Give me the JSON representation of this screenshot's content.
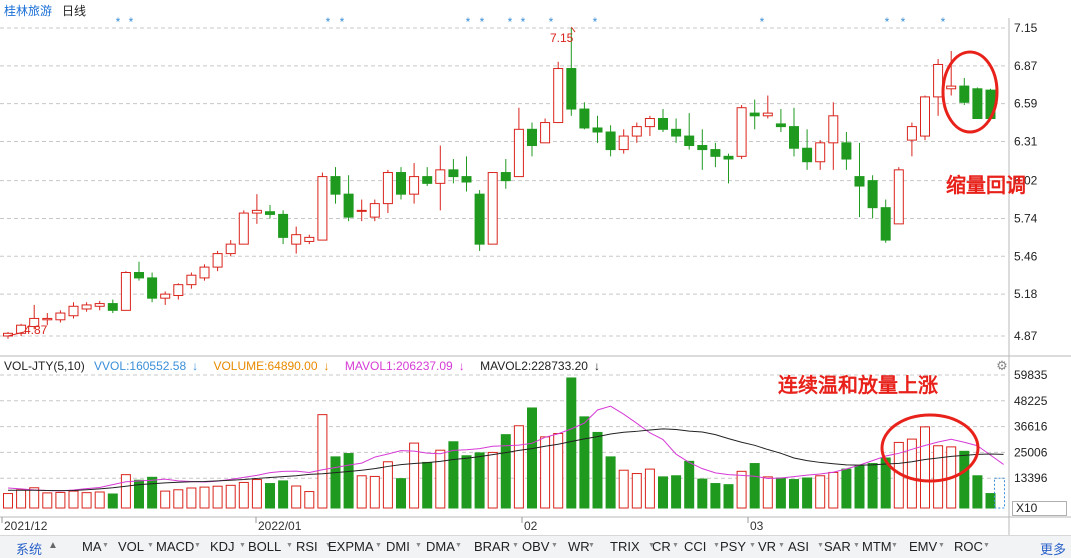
{
  "header": {
    "stock_name": "桂林旅游",
    "period": "日线"
  },
  "price_axis": [
    "7.15",
    "6.87",
    "6.59",
    "6.31",
    "6.02",
    "5.74",
    "5.46",
    "5.18",
    "4.87"
  ],
  "volume_axis": [
    "59835",
    "48225",
    "36616",
    "25006",
    "13396"
  ],
  "date_labels": [
    "2021/12",
    "2022/01",
    "02",
    "03"
  ],
  "peak_label": "7.15",
  "low_label": "4.87",
  "annotations": {
    "top_right": "缩量回调",
    "bottom_right": "连续温和放量上涨"
  },
  "volume_indicator": {
    "name": "VOL-JTY(5,10)",
    "vvol": "VVOL:160552.58",
    "volume": "VOLUME:64890.00",
    "mavol1": "MAVOL1:206237.09",
    "mavol2": "MAVOL2:228733.20",
    "arrow": "↓"
  },
  "x10_label": "X10",
  "bottom_tabs": [
    "系统",
    "MA",
    "VOL",
    "MACD",
    "KDJ",
    "BOLL",
    "RSI",
    "EXPMA",
    "DMI",
    "DMA",
    "BRAR",
    "OBV",
    "WR",
    "TRIX",
    "CR",
    "CCI",
    "PSY",
    "VR",
    "ASI",
    "SAR",
    "MTM",
    "EMV",
    "ROC"
  ],
  "more_label": "更多",
  "colors": {
    "up": "#d9231b",
    "down": "#1f9a1f",
    "ma1": "#d63ad6",
    "ma2": "#222222",
    "vvol": "#3a8fd9",
    "volume": "#e88a00",
    "grid": "#c8c8c8",
    "circle": "#e8221b"
  },
  "chart_data": {
    "type": "candlestick",
    "price_ylim": [
      4.87,
      7.15
    ],
    "volume_ylim": [
      0,
      59835
    ],
    "candles": [
      {
        "o": 4.87,
        "h": 4.9,
        "l": 4.85,
        "c": 4.89,
        "v": 6500
      },
      {
        "o": 4.89,
        "h": 4.96,
        "l": 4.87,
        "c": 4.95,
        "v": 8200
      },
      {
        "o": 4.94,
        "h": 5.1,
        "l": 4.92,
        "c": 5.0,
        "v": 9100
      },
      {
        "o": 4.99,
        "h": 5.04,
        "l": 4.95,
        "c": 5.0,
        "v": 6800
      },
      {
        "o": 4.99,
        "h": 5.06,
        "l": 4.97,
        "c": 5.04,
        "v": 7000
      },
      {
        "o": 5.02,
        "h": 5.12,
        "l": 5.0,
        "c": 5.09,
        "v": 7600
      },
      {
        "o": 5.07,
        "h": 5.12,
        "l": 5.05,
        "c": 5.1,
        "v": 6900
      },
      {
        "o": 5.09,
        "h": 5.13,
        "l": 5.06,
        "c": 5.11,
        "v": 7200
      },
      {
        "o": 5.11,
        "h": 5.14,
        "l": 5.04,
        "c": 5.06,
        "v": 6300
      },
      {
        "o": 5.06,
        "h": 5.35,
        "l": 5.06,
        "c": 5.34,
        "v": 15000
      },
      {
        "o": 5.34,
        "h": 5.42,
        "l": 5.28,
        "c": 5.3,
        "v": 12500
      },
      {
        "o": 5.3,
        "h": 5.34,
        "l": 5.12,
        "c": 5.15,
        "v": 13800
      },
      {
        "o": 5.15,
        "h": 5.2,
        "l": 5.1,
        "c": 5.18,
        "v": 7600
      },
      {
        "o": 5.17,
        "h": 5.26,
        "l": 5.14,
        "c": 5.25,
        "v": 8200
      },
      {
        "o": 5.25,
        "h": 5.34,
        "l": 5.22,
        "c": 5.32,
        "v": 9000
      },
      {
        "o": 5.3,
        "h": 5.4,
        "l": 5.28,
        "c": 5.38,
        "v": 9400
      },
      {
        "o": 5.38,
        "h": 5.5,
        "l": 5.35,
        "c": 5.48,
        "v": 9800
      },
      {
        "o": 5.48,
        "h": 5.58,
        "l": 5.46,
        "c": 5.55,
        "v": 10200
      },
      {
        "o": 5.55,
        "h": 5.8,
        "l": 5.55,
        "c": 5.78,
        "v": 11500
      },
      {
        "o": 5.78,
        "h": 5.92,
        "l": 5.7,
        "c": 5.8,
        "v": 12800
      },
      {
        "o": 5.79,
        "h": 5.84,
        "l": 5.74,
        "c": 5.77,
        "v": 11000
      },
      {
        "o": 5.77,
        "h": 5.8,
        "l": 5.55,
        "c": 5.6,
        "v": 12200
      },
      {
        "o": 5.55,
        "h": 5.68,
        "l": 5.48,
        "c": 5.62,
        "v": 9900
      },
      {
        "o": 5.57,
        "h": 5.62,
        "l": 5.55,
        "c": 5.6,
        "v": 7400
      },
      {
        "o": 5.58,
        "h": 6.08,
        "l": 5.58,
        "c": 6.05,
        "v": 42000
      },
      {
        "o": 6.05,
        "h": 6.12,
        "l": 5.85,
        "c": 5.92,
        "v": 23000
      },
      {
        "o": 5.92,
        "h": 6.06,
        "l": 5.72,
        "c": 5.75,
        "v": 24500
      },
      {
        "o": 5.8,
        "h": 5.88,
        "l": 5.72,
        "c": 5.8,
        "v": 14500
      },
      {
        "o": 5.75,
        "h": 5.88,
        "l": 5.72,
        "c": 5.85,
        "v": 14200
      },
      {
        "o": 5.85,
        "h": 6.1,
        "l": 5.78,
        "c": 6.08,
        "v": 20800
      },
      {
        "o": 6.08,
        "h": 6.12,
        "l": 5.88,
        "c": 5.92,
        "v": 13200
      },
      {
        "o": 5.92,
        "h": 6.15,
        "l": 5.85,
        "c": 6.05,
        "v": 29200
      },
      {
        "o": 6.05,
        "h": 6.12,
        "l": 5.98,
        "c": 6.0,
        "v": 20500
      },
      {
        "o": 6.0,
        "h": 6.28,
        "l": 5.8,
        "c": 6.1,
        "v": 26000
      },
      {
        "o": 6.1,
        "h": 6.18,
        "l": 6.0,
        "c": 6.05,
        "v": 29800
      },
      {
        "o": 6.05,
        "h": 6.2,
        "l": 5.94,
        "c": 6.01,
        "v": 23500
      },
      {
        "o": 5.92,
        "h": 5.95,
        "l": 5.5,
        "c": 5.55,
        "v": 24800
      },
      {
        "o": 5.55,
        "h": 6.08,
        "l": 5.55,
        "c": 6.08,
        "v": 25000
      },
      {
        "o": 6.08,
        "h": 6.18,
        "l": 5.96,
        "c": 6.02,
        "v": 33000
      },
      {
        "o": 6.05,
        "h": 6.56,
        "l": 6.05,
        "c": 6.4,
        "v": 37000
      },
      {
        "o": 6.4,
        "h": 6.45,
        "l": 6.2,
        "c": 6.28,
        "v": 45000
      },
      {
        "o": 6.3,
        "h": 6.48,
        "l": 6.3,
        "c": 6.45,
        "v": 32000
      },
      {
        "o": 6.45,
        "h": 6.9,
        "l": 6.45,
        "c": 6.85,
        "v": 33500
      },
      {
        "o": 6.85,
        "h": 7.15,
        "l": 6.5,
        "c": 6.55,
        "v": 58500
      },
      {
        "o": 6.55,
        "h": 6.6,
        "l": 6.4,
        "c": 6.41,
        "v": 41000
      },
      {
        "o": 6.41,
        "h": 6.5,
        "l": 6.3,
        "c": 6.38,
        "v": 34000
      },
      {
        "o": 6.38,
        "h": 6.43,
        "l": 6.2,
        "c": 6.25,
        "v": 23000
      },
      {
        "o": 6.25,
        "h": 6.4,
        "l": 6.22,
        "c": 6.35,
        "v": 17000
      },
      {
        "o": 6.35,
        "h": 6.45,
        "l": 6.3,
        "c": 6.42,
        "v": 15500
      },
      {
        "o": 6.42,
        "h": 6.5,
        "l": 6.35,
        "c": 6.48,
        "v": 17500
      },
      {
        "o": 6.48,
        "h": 6.55,
        "l": 6.38,
        "c": 6.4,
        "v": 14000
      },
      {
        "o": 6.4,
        "h": 6.48,
        "l": 6.3,
        "c": 6.35,
        "v": 14500
      },
      {
        "o": 6.35,
        "h": 6.52,
        "l": 6.25,
        "c": 6.28,
        "v": 21000
      },
      {
        "o": 6.28,
        "h": 6.4,
        "l": 6.1,
        "c": 6.25,
        "v": 13000
      },
      {
        "o": 6.25,
        "h": 6.3,
        "l": 6.12,
        "c": 6.2,
        "v": 11000
      },
      {
        "o": 6.2,
        "h": 6.22,
        "l": 6.0,
        "c": 6.18,
        "v": 10500
      },
      {
        "o": 6.2,
        "h": 6.58,
        "l": 6.18,
        "c": 6.56,
        "v": 16500
      },
      {
        "o": 6.52,
        "h": 6.62,
        "l": 6.4,
        "c": 6.5,
        "v": 20000
      },
      {
        "o": 6.5,
        "h": 6.65,
        "l": 6.48,
        "c": 6.52,
        "v": 14000
      },
      {
        "o": 6.44,
        "h": 6.55,
        "l": 6.38,
        "c": 6.42,
        "v": 13500
      },
      {
        "o": 6.42,
        "h": 6.56,
        "l": 6.2,
        "c": 6.26,
        "v": 12800
      },
      {
        "o": 6.26,
        "h": 6.4,
        "l": 6.1,
        "c": 6.16,
        "v": 13500
      },
      {
        "o": 6.16,
        "h": 6.32,
        "l": 6.1,
        "c": 6.3,
        "v": 14500
      },
      {
        "o": 6.3,
        "h": 6.6,
        "l": 6.1,
        "c": 6.5,
        "v": 16000
      },
      {
        "o": 6.3,
        "h": 6.38,
        "l": 6.1,
        "c": 6.18,
        "v": 17500
      },
      {
        "o": 6.05,
        "h": 6.3,
        "l": 5.75,
        "c": 5.98,
        "v": 19000
      },
      {
        "o": 6.02,
        "h": 6.06,
        "l": 5.74,
        "c": 5.82,
        "v": 20000
      },
      {
        "o": 5.82,
        "h": 5.88,
        "l": 5.56,
        "c": 5.58,
        "v": 22500
      },
      {
        "o": 5.7,
        "h": 6.12,
        "l": 5.7,
        "c": 6.1,
        "v": 29500
      },
      {
        "o": 6.32,
        "h": 6.45,
        "l": 6.2,
        "c": 6.42,
        "v": 31000
      },
      {
        "o": 6.35,
        "h": 6.65,
        "l": 6.32,
        "c": 6.64,
        "v": 36500
      },
      {
        "o": 6.64,
        "h": 6.92,
        "l": 6.5,
        "c": 6.88,
        "v": 28000
      },
      {
        "o": 6.7,
        "h": 6.98,
        "l": 6.65,
        "c": 6.72,
        "v": 27500
      },
      {
        "o": 6.72,
        "h": 6.78,
        "l": 6.58,
        "c": 6.6,
        "v": 25500
      },
      {
        "o": 6.7,
        "h": 6.71,
        "l": 6.48,
        "c": 6.48,
        "v": 14500
      },
      {
        "o": 6.69,
        "h": 6.7,
        "l": 6.48,
        "c": 6.48,
        "v": 6500
      }
    ],
    "mavol1": [
      9000,
      8600,
      8100,
      7900,
      7700,
      8100,
      8700,
      9200,
      10500,
      11800,
      12200,
      12500,
      13000,
      12200,
      11900,
      11700,
      12100,
      12900,
      13800,
      14700,
      15900,
      16500,
      16600,
      16000,
      17200,
      18200,
      19300,
      20200,
      22900,
      24300,
      25800,
      25600,
      24700,
      24400,
      25900,
      26200,
      26700,
      27800,
      28000,
      28300,
      29100,
      31800,
      33400,
      35600,
      38200,
      44100,
      45800,
      42200,
      38100,
      33800,
      30800,
      24200,
      20500,
      17700,
      15800,
      15000,
      14700,
      14300,
      13300,
      13500,
      14100,
      14800,
      15300,
      16100,
      17600,
      19300,
      21300,
      23400,
      24600,
      26400,
      28100,
      29700,
      30900,
      29600,
      28000,
      23800,
      19600
    ],
    "mavol2": [
      8000,
      8000,
      8000,
      7900,
      7800,
      7900,
      8200,
      8600,
      9100,
      9800,
      10500,
      10900,
      11300,
      11600,
      11800,
      11900,
      12200,
      12500,
      12800,
      13300,
      13700,
      14100,
      14500,
      15100,
      15400,
      15900,
      16400,
      17000,
      17700,
      18700,
      19500,
      20000,
      20400,
      21000,
      21800,
      22400,
      23100,
      24000,
      24900,
      25900,
      26700,
      27800,
      28700,
      29900,
      31100,
      32100,
      33300,
      34100,
      34500,
      35100,
      35600,
      35300,
      34600,
      34200,
      33000,
      31200,
      29600,
      28200,
      26300,
      24600,
      22500,
      21300,
      20500,
      19900,
      19400,
      19300,
      19400,
      19800,
      20100,
      20800,
      21800,
      22500,
      23200,
      23700,
      24100,
      24300,
      24100
    ]
  }
}
